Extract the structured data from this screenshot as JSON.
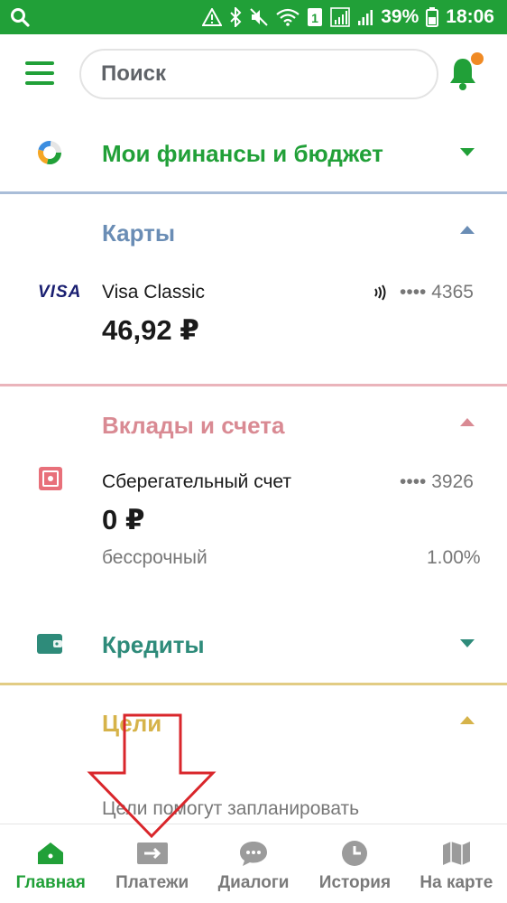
{
  "status_bar": {
    "battery": "39%",
    "time": "18:06",
    "sim_badge": "1"
  },
  "header": {
    "search_placeholder": "Поиск"
  },
  "sections": {
    "finances": {
      "title": "Мои финансы и бюджет",
      "color": "#21a038"
    },
    "cards": {
      "title": "Карты",
      "color": "#6a8db5",
      "items": [
        {
          "brand": "VISA",
          "name": "Visa Classic",
          "masked_number": "•••• 4365",
          "amount": "46,92 ₽"
        }
      ]
    },
    "deposits": {
      "title": "Вклады и счета",
      "color": "#d98a93",
      "items": [
        {
          "name": "Сберегательный счет",
          "masked_number": "•••• 3926",
          "amount": "0 ₽",
          "term": "бессрочный",
          "rate": "1.00%"
        }
      ]
    },
    "credits": {
      "title": "Кредиты",
      "color": "#2e8b7a"
    },
    "goals": {
      "title": "Цели",
      "color": "#d6b34a",
      "hint": "Цели помогут запланировать"
    }
  },
  "bottom_nav": {
    "items": [
      {
        "label": "Главная",
        "icon": "home-icon",
        "active": true
      },
      {
        "label": "Платежи",
        "icon": "payments-arrow-icon",
        "active": false
      },
      {
        "label": "Диалоги",
        "icon": "chat-bubble-icon",
        "active": false
      },
      {
        "label": "История",
        "icon": "clock-icon",
        "active": false
      },
      {
        "label": "На карте",
        "icon": "map-icon",
        "active": false
      }
    ]
  },
  "colors": {
    "brand_green": "#21a038",
    "notification_orange": "#f08a24",
    "annotation_red": "#d9262b"
  }
}
